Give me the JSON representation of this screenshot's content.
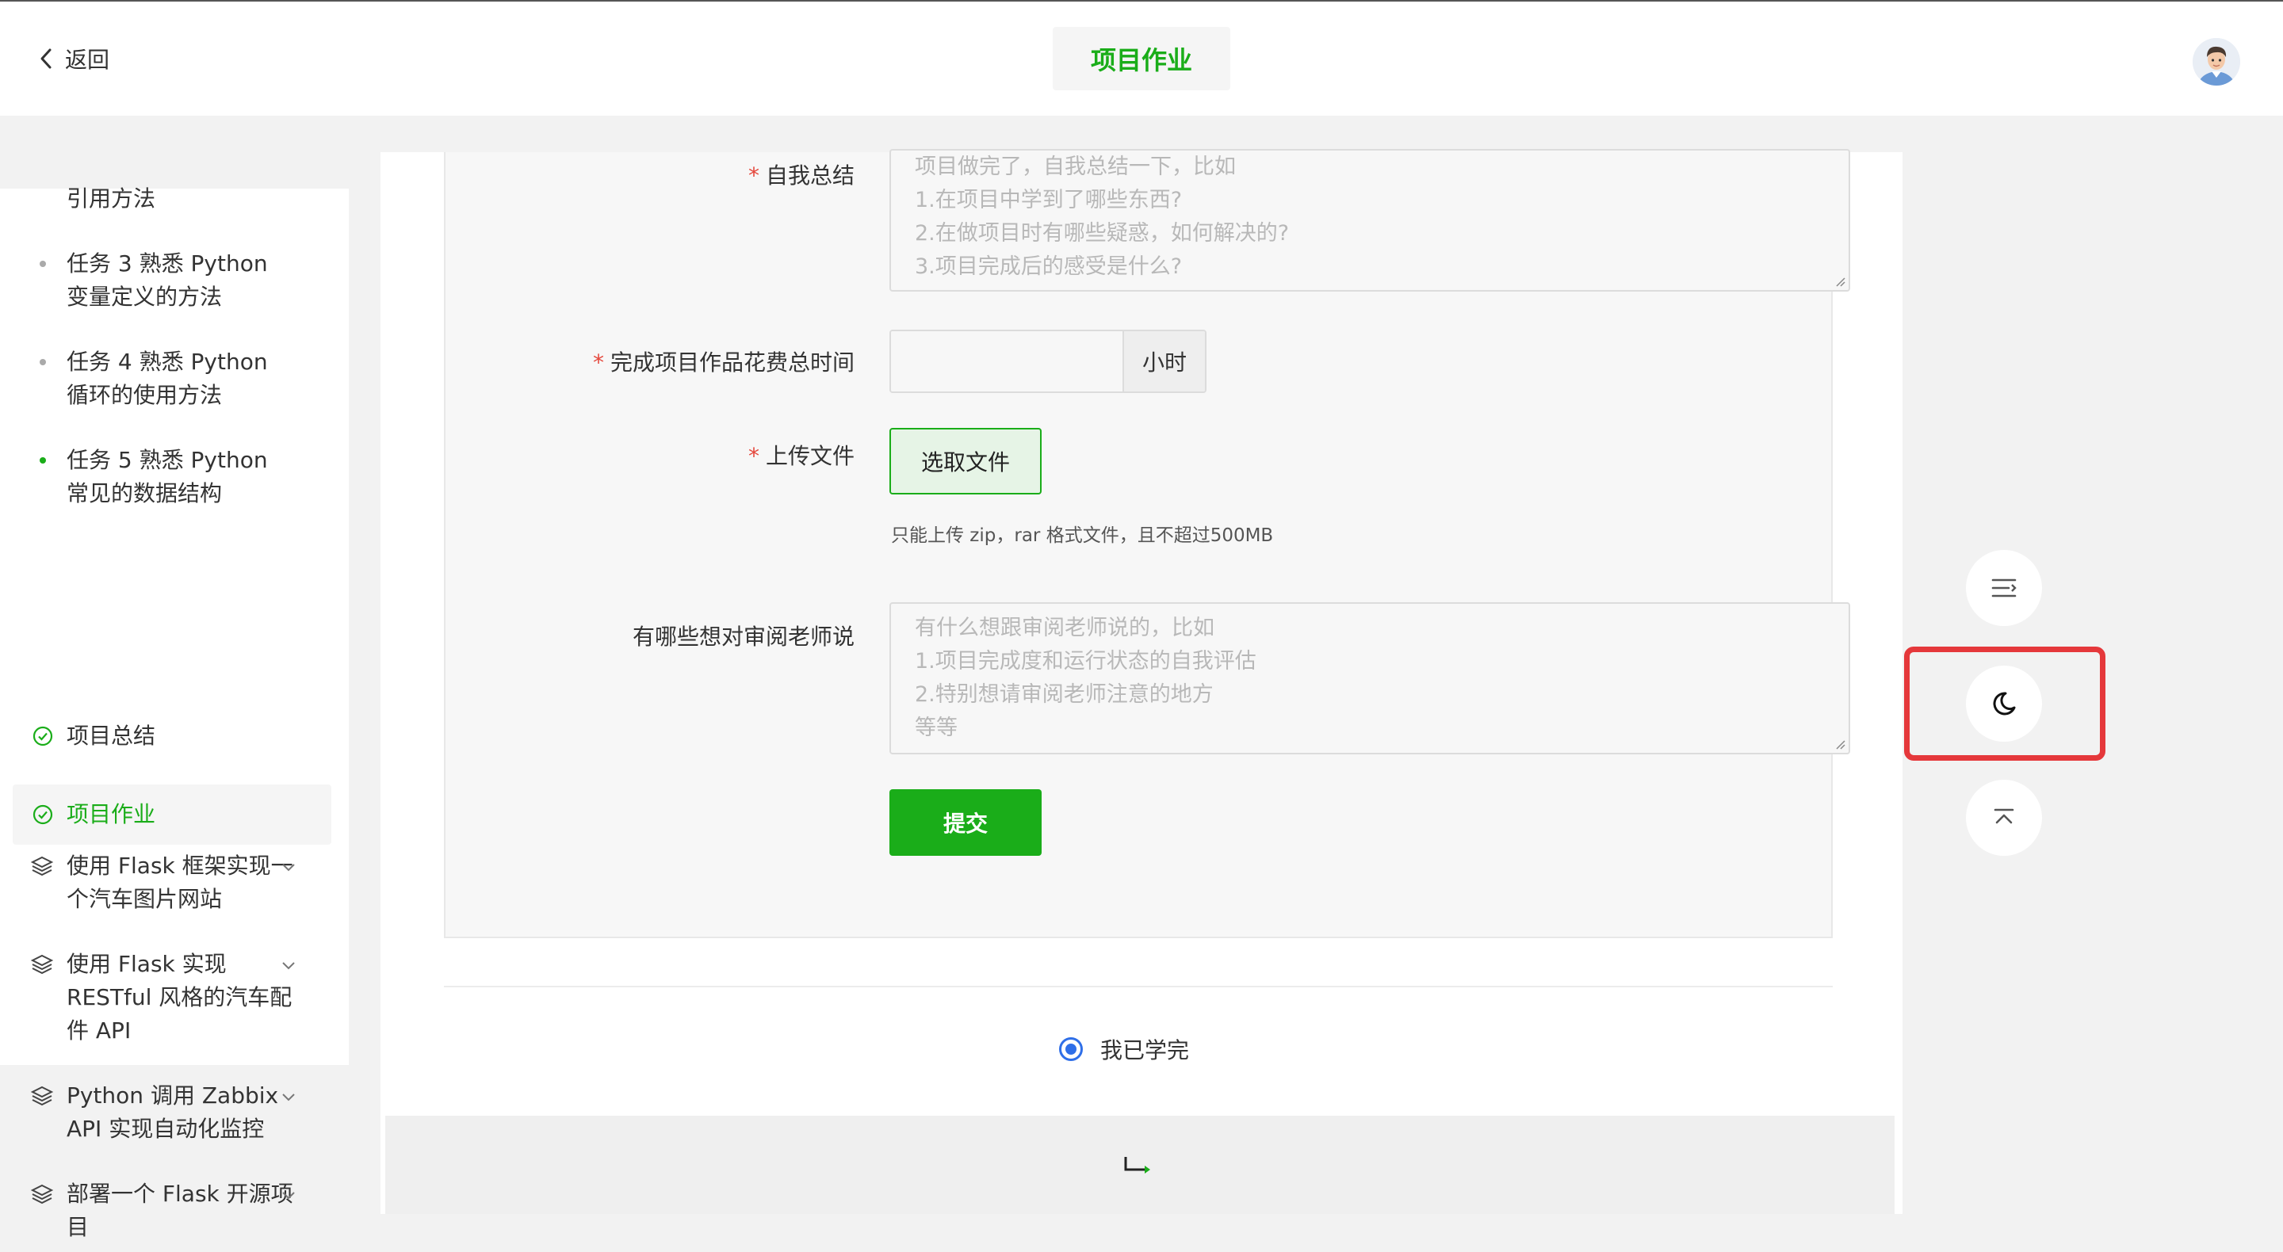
{
  "header": {
    "back_label": "返回",
    "title": "项目作业"
  },
  "sidebar": {
    "items": [
      {
        "label": "引用方法",
        "marker": "none"
      },
      {
        "label": "任务 3 熟悉 Python 变量定义的方法",
        "marker": "dot"
      },
      {
        "label": "任务 4 熟悉 Python 循环的使用方法",
        "marker": "dot"
      },
      {
        "label": "任务 5 熟悉 Python 常见的数据结构",
        "marker": "dot-green"
      },
      {
        "label": "项目总结",
        "marker": "check-circle-icon"
      },
      {
        "label": "项目作业",
        "marker": "check-circle-icon",
        "active": true
      },
      {
        "label": "使用 Flask 框架实现一个汽车图片网站",
        "marker": "layers-icon"
      },
      {
        "label": "使用 Flask 实现 RESTful 风格的汽车配件 API",
        "marker": "layers-icon"
      },
      {
        "label": "Python 调用 Zabbix API 实现自动化监控",
        "marker": "layers-icon"
      },
      {
        "label": "部署一个 Flask 开源项目",
        "marker": "layers-icon"
      }
    ]
  },
  "form": {
    "summary": {
      "label": "自我总结",
      "required_mark": "*",
      "placeholder_lines": [
        "项目做完了，自我总结一下，比如",
        "1.在项目中学到了哪些东西?",
        "2.在做项目时有哪些疑惑，如何解决的?",
        "3.项目完成后的感受是什么?"
      ]
    },
    "time": {
      "label": "完成项目作品花费总时间",
      "required_mark": "*",
      "value": "",
      "unit": "小时"
    },
    "upload": {
      "label": "上传文件",
      "required_mark": "*",
      "button_label": "选取文件",
      "hint": "只能上传 zip，rar 格式文件，且不超过500MB"
    },
    "reviewer_note": {
      "label": "有哪些想对审阅老师说",
      "placeholder_lines": [
        "有什么想跟审阅老师说的，比如",
        "1.项目完成度和运行状态的自我评估",
        "2.特别想请审阅老师注意的地方",
        "等等"
      ]
    },
    "submit_label": "提交"
  },
  "completion": {
    "label": "我已学完",
    "checked": true
  },
  "float_tools": [
    {
      "icon": "outline-toggle-icon"
    },
    {
      "icon": "moon-icon",
      "highlighted": true
    },
    {
      "icon": "back-to-top-icon"
    }
  ],
  "colors": {
    "accent_green": "#1aad19",
    "required_red": "#e5483d",
    "radio_blue": "#2f6fe8",
    "highlight_red": "#e5383b"
  }
}
